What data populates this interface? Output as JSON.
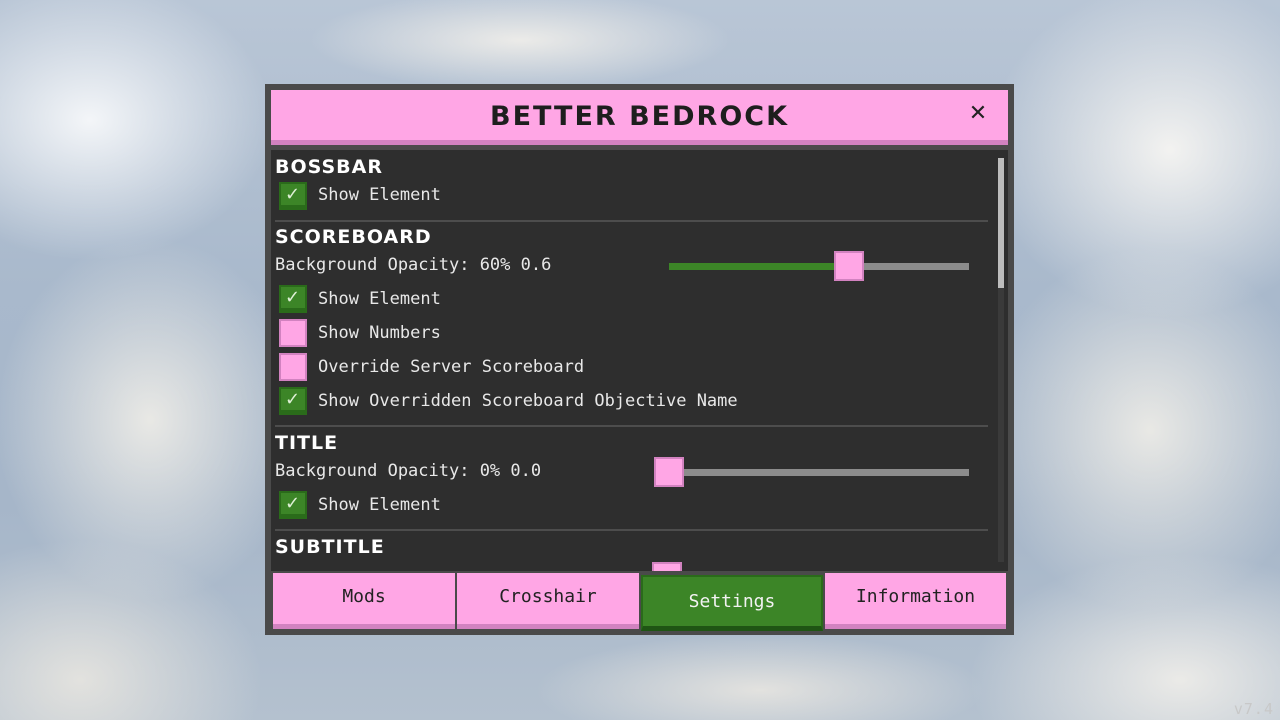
{
  "window": {
    "title": "BETTER BEDROCK",
    "close_label": "✕"
  },
  "version": "v7.4",
  "sections": [
    {
      "title": "BOSSBAR",
      "rows": [
        {
          "type": "checkbox",
          "label": "Show Element",
          "checked": true
        }
      ]
    },
    {
      "title": "SCOREBOARD",
      "rows": [
        {
          "type": "slider",
          "label": "Background Opacity: 60% 0.6",
          "value": 0.6
        },
        {
          "type": "checkbox",
          "label": "Show Element",
          "checked": true
        },
        {
          "type": "checkbox",
          "label": "Show Numbers",
          "checked": false
        },
        {
          "type": "checkbox",
          "label": "Override Server Scoreboard",
          "checked": false
        },
        {
          "type": "checkbox",
          "label": "Show Overridden Scoreboard Objective Name",
          "checked": true
        }
      ]
    },
    {
      "title": "TITLE",
      "rows": [
        {
          "type": "slider",
          "label": "Background Opacity: 0% 0.0",
          "value": 0.0
        },
        {
          "type": "checkbox",
          "label": "Show Element",
          "checked": true
        }
      ]
    },
    {
      "title": "SUBTITLE",
      "rows": []
    }
  ],
  "tabs": [
    {
      "label": "Mods",
      "active": false
    },
    {
      "label": "Crosshair",
      "active": false
    },
    {
      "label": "Settings",
      "active": true
    },
    {
      "label": "Information",
      "active": false
    }
  ],
  "colors": {
    "accent_pink": "#ffa6e5",
    "accent_green": "#3c8527",
    "panel_bg": "#2e2e2e"
  }
}
